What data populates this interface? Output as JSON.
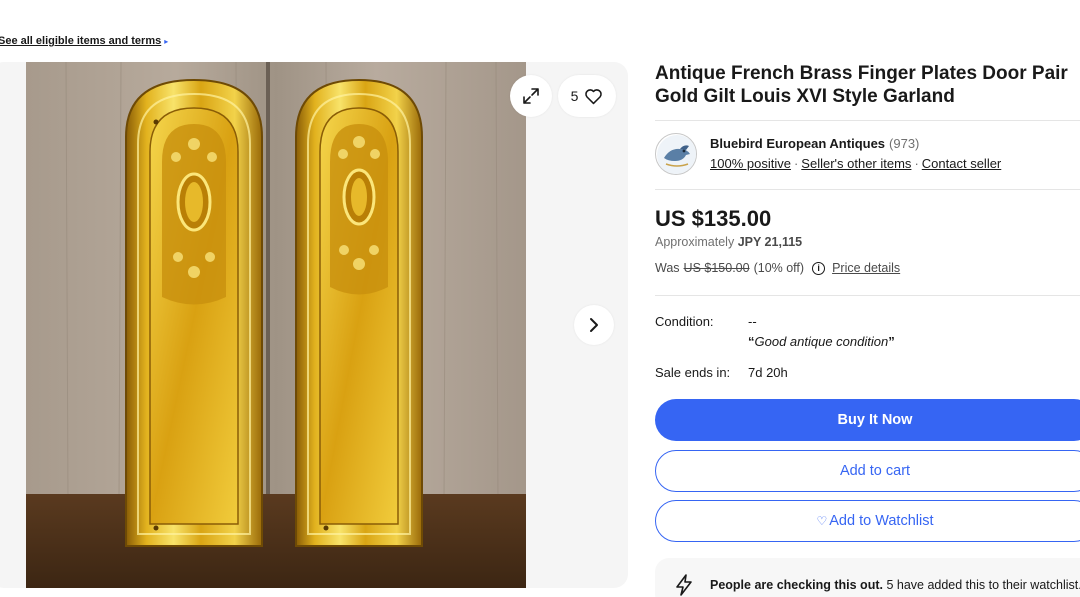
{
  "eligible_link": {
    "label": "See all eligible items and terms",
    "arrow": "▸"
  },
  "gallery": {
    "image_alt": "Two brass finger plates",
    "watch_count": "5",
    "icons": {
      "expand": "expand-icon",
      "heart": "heart-icon",
      "next": "chevron-right-icon"
    }
  },
  "listing": {
    "title": "Antique French Brass Finger Plates Door Pair Gold Gilt Louis XVI Style Garland"
  },
  "seller": {
    "name": "Bluebird European Antiques",
    "feedback_count": "(973)",
    "positive": "100% positive",
    "other_items": "Seller's other items",
    "contact": "Contact seller",
    "separator": "·"
  },
  "pricing": {
    "price": "US $135.00",
    "approx_prefix": "Approximately",
    "approx_value": "JPY 21,115",
    "was_prefix": "Was",
    "was_value": "US $150.00",
    "discount": "(10% off)",
    "info_symbol": "i",
    "price_details": "Price details"
  },
  "details": {
    "condition_label": "Condition:",
    "condition_value": "--",
    "condition_quote": "Good antique condition",
    "open_quote": "“",
    "close_quote": "”",
    "sale_label": "Sale ends in:",
    "sale_value": "7d 20h"
  },
  "actions": {
    "buy_now": "Buy It Now",
    "add_to_cart": "Add to cart",
    "add_to_watchlist": "Add to Watchlist",
    "heart_symbol": "♡"
  },
  "signal": {
    "bold": "People are checking this out.",
    "rest": " 5 have added this to their watchlist."
  },
  "colors": {
    "accent": "#3665f3",
    "text": "#191919",
    "muted": "#707070",
    "brass": "#d9a514"
  }
}
